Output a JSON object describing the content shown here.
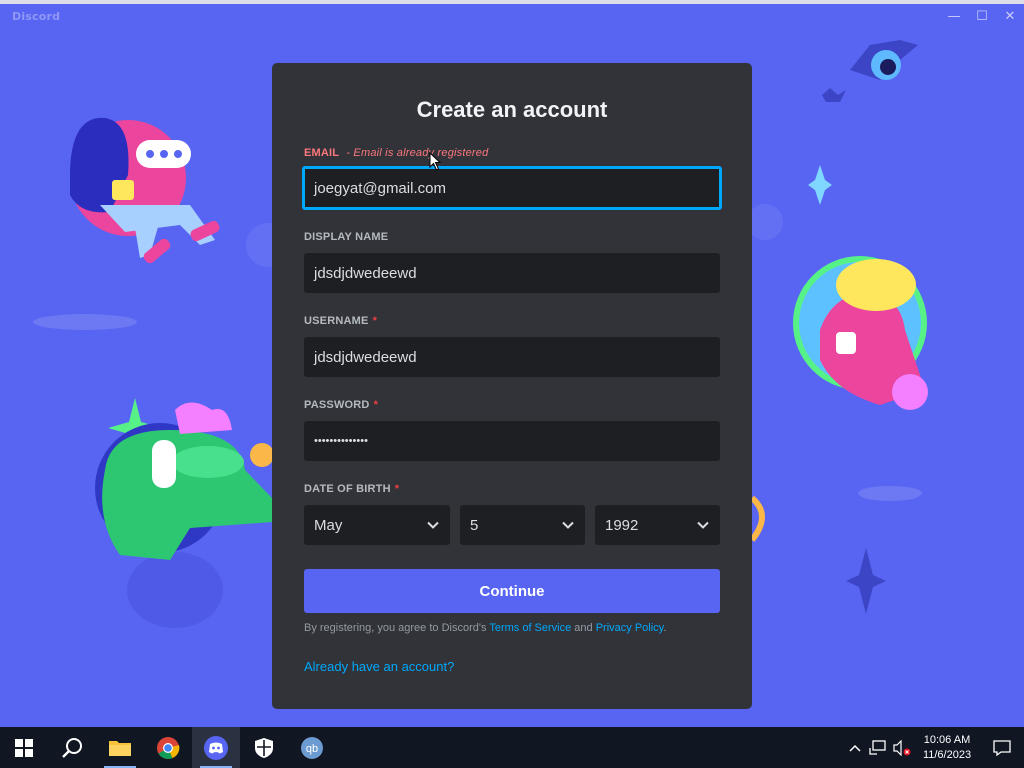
{
  "window": {
    "app_name": "Discord",
    "controls": {
      "minimize": "—",
      "maximize": "☐",
      "close": "✕"
    }
  },
  "form": {
    "title": "Create an account",
    "email": {
      "label": "EMAIL",
      "error": "- Email is already registered",
      "value": "joegyat@gmail.com"
    },
    "display_name": {
      "label": "DISPLAY NAME",
      "value": "jdsdjdwedeewd"
    },
    "username": {
      "label": "USERNAME",
      "required": "*",
      "value": "jdsdjdwedeewd"
    },
    "password": {
      "label": "PASSWORD",
      "required": "*",
      "value": "••••••••••••••"
    },
    "dob": {
      "label": "DATE OF BIRTH",
      "required": "*",
      "month": "May",
      "day": "5",
      "year": "1992"
    },
    "continue_label": "Continue",
    "terms": {
      "prefix": "By registering, you agree to Discord's ",
      "tos": "Terms of Service",
      "and": " and ",
      "privacy": "Privacy Policy",
      "suffix": "."
    },
    "login_link": "Already have an account?"
  },
  "taskbar": {
    "clock": {
      "time": "10:06 AM",
      "date": "11/6/2023"
    }
  },
  "colors": {
    "blurple": "#5865f2",
    "card_bg": "#313338",
    "input_bg": "#1e1f22",
    "link": "#00a8fc",
    "error": "#fa777c"
  }
}
